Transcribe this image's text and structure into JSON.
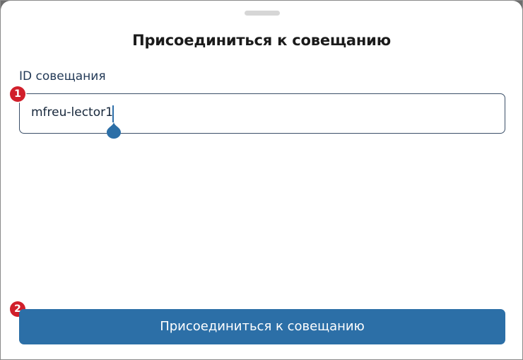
{
  "dialog": {
    "title": "Присоединиться к совещанию"
  },
  "meeting_id_field": {
    "label": "ID совещания",
    "value": "mfreu-lector1"
  },
  "join_button": {
    "label": "Присоединиться к совещанию"
  },
  "callouts": [
    "1",
    "2"
  ],
  "colors": {
    "primary": "#2c6fa7",
    "callout": "#d11f2b",
    "input_border": "#3b4f68"
  }
}
